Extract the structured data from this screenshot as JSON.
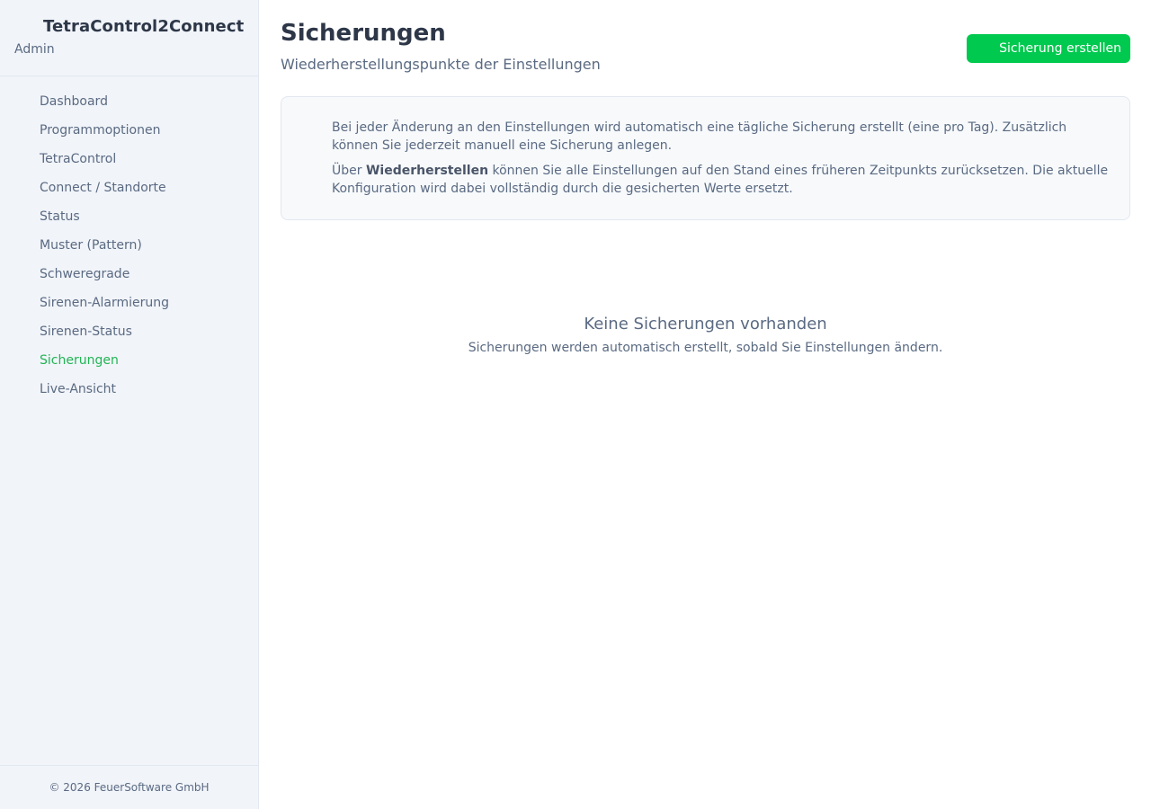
{
  "app": {
    "title": "TetraControl2Connect",
    "user": "Admin"
  },
  "sidebar": {
    "items": [
      {
        "label": "Dashboard",
        "icon": "dashboard-icon",
        "active": false
      },
      {
        "label": "Programmoptionen",
        "icon": "settings-icon",
        "active": false
      },
      {
        "label": "TetraControl",
        "icon": "radio-icon",
        "active": false
      },
      {
        "label": "Connect / Standorte",
        "icon": "location-icon",
        "active": false
      },
      {
        "label": "Status",
        "icon": "status-icon",
        "active": false
      },
      {
        "label": "Muster (Pattern)",
        "icon": "pattern-icon",
        "active": false
      },
      {
        "label": "Schweregrade",
        "icon": "severity-icon",
        "active": false
      },
      {
        "label": "Sirenen-Alarmierung",
        "icon": "siren-icon",
        "active": false
      },
      {
        "label": "Sirenen-Status",
        "icon": "siren-status-icon",
        "active": false
      },
      {
        "label": "Sicherungen",
        "icon": "backup-icon",
        "active": true
      },
      {
        "label": "Live-Ansicht",
        "icon": "live-icon",
        "active": false
      }
    ],
    "footer": "© 2026 FeuerSoftware GmbH"
  },
  "page": {
    "title": "Sicherungen",
    "subtitle": "Wiederherstellungspunkte der Einstellungen",
    "create_button": "Sicherung erstellen"
  },
  "info": {
    "paragraph1": "Bei jeder Änderung an den Einstellungen wird automatisch eine tägliche Sicherung erstellt (eine pro Tag). Zusätzlich können Sie jederzeit manuell eine Sicherung anlegen.",
    "paragraph2_prefix": "Über ",
    "paragraph2_bold": "Wiederherstellen",
    "paragraph2_suffix": " können Sie alle Einstellungen auf den Stand eines früheren Zeitpunkts zurücksetzen. Die aktuelle Konfiguration wird dabei vollständig durch die gesicherten Werte ersetzt."
  },
  "empty_state": {
    "title": "Keine Sicherungen vorhanden",
    "message": "Sicherungen werden automatisch erstellt, sobald Sie Einstellungen ändern."
  },
  "colors": {
    "accent": "#00c94f",
    "active_nav": "#22b455",
    "sidebar_bg": "#f1f4f9",
    "text_muted": "#5a6a82"
  }
}
